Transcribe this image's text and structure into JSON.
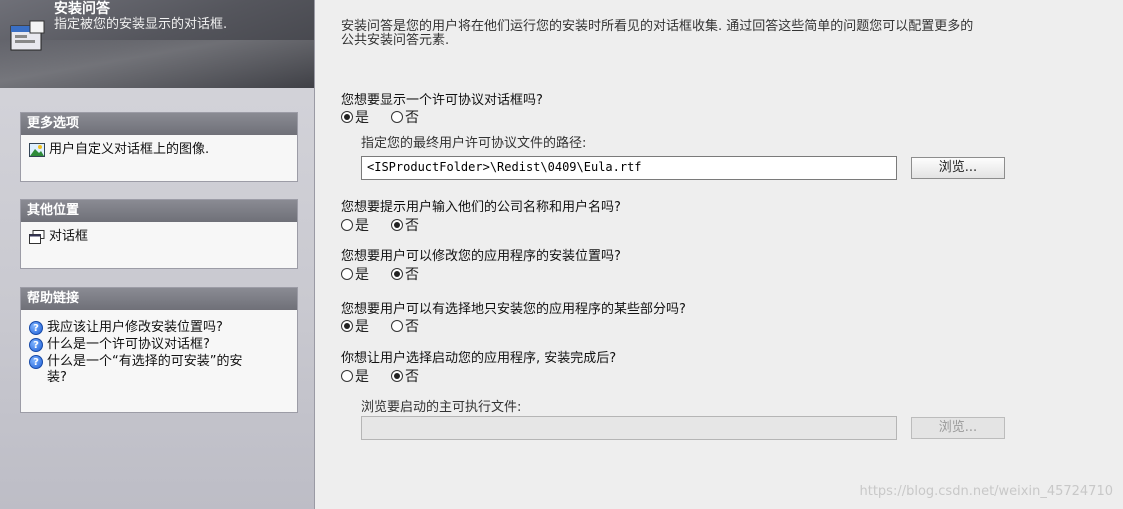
{
  "banner": {
    "title": "安装问答",
    "subtitle": "指定被您的安装显示的对话框."
  },
  "sidebar": {
    "more_options": {
      "title": "更多选项",
      "items": [
        {
          "label": "用户自定义对话框上的图像.",
          "icon": "image-icon"
        }
      ]
    },
    "other_locations": {
      "title": "其他位置",
      "items": [
        {
          "label": "对话框",
          "icon": "dialog-icon"
        }
      ]
    },
    "help_links": {
      "title": "帮助链接",
      "items": [
        {
          "label": "我应该让用户修改安装位置吗?",
          "icon": "help-icon"
        },
        {
          "label": "什么是一个许可协议对话框?",
          "icon": "help-icon"
        },
        {
          "label": "什么是一个“有选择的可安装”的安装?",
          "icon": "help-icon"
        }
      ]
    }
  },
  "main": {
    "intro": "安装问答是您的用户将在他们运行您的安装时所看见的对话框收集. 通过回答这些简单的问题您可以配置更多的公共安装问答元素.",
    "yes_label": "是",
    "no_label": "否",
    "q1": {
      "question": "您想要显示一个许可协议对话框吗?",
      "selected": "yes",
      "path_label": "指定您的最终用户许可协议文件的路径:",
      "path_value": "<ISProductFolder>\\Redist\\0409\\Eula.rtf",
      "browse_label": "浏览..."
    },
    "q2": {
      "question": "您想要提示用户输入他们的公司名称和用户名吗?",
      "selected": "no"
    },
    "q3": {
      "question": "您想要用户可以修改您的应用程序的安装位置吗?",
      "selected": "no"
    },
    "q4": {
      "question": "您想要用户可以有选择地只安装您的应用程序的某些部分吗?",
      "selected": "yes"
    },
    "q5": {
      "question": "你想让用户选择启动您的应用程序, 安装完成后?",
      "selected": "no",
      "exe_label": "浏览要启动的主可执行文件:",
      "exe_value": "",
      "browse_label": "浏览..."
    }
  },
  "watermark": "https://blog.csdn.net/weixin_45724710"
}
